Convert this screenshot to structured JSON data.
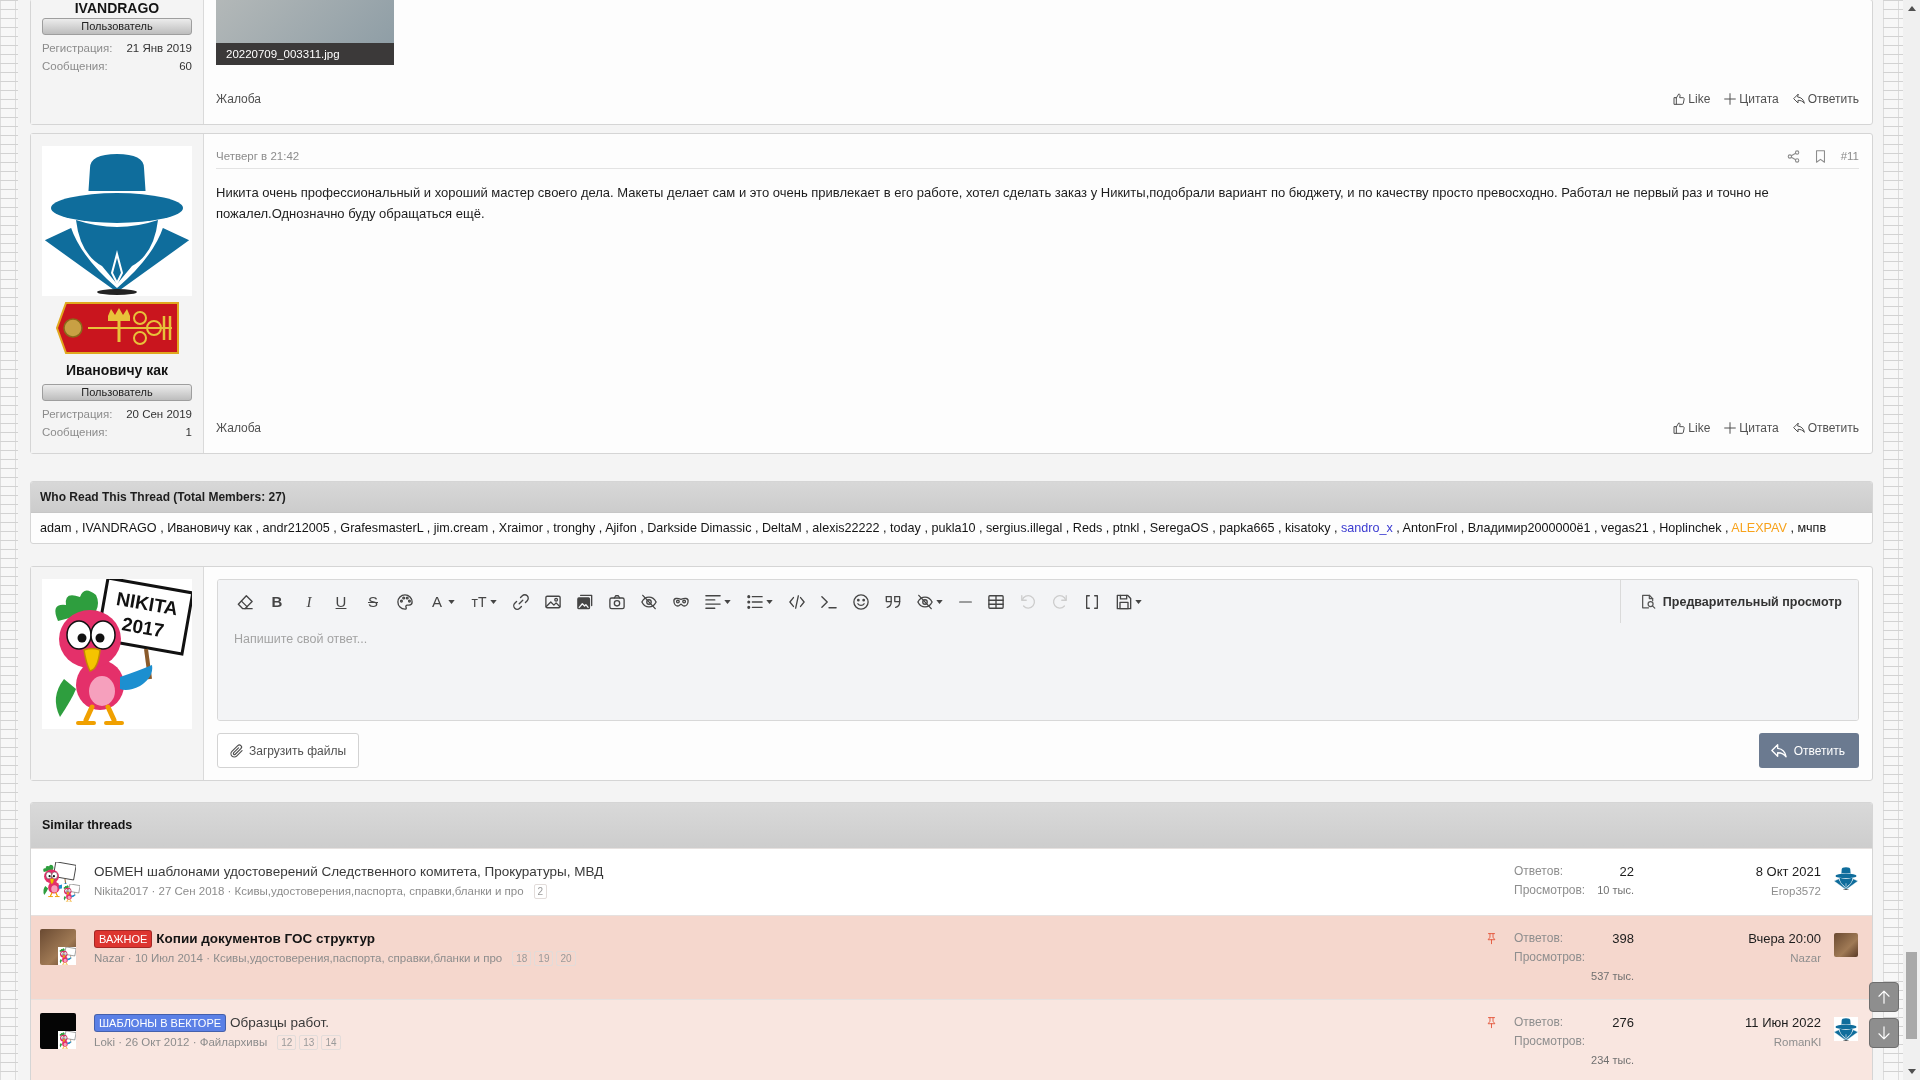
{
  "posts": [
    {
      "author": "IVANDRAGO",
      "role": "Пользователь",
      "stats": [
        {
          "label": "Регистрация:",
          "value": "21 Янв 2019"
        },
        {
          "label": "Сообщения:",
          "value": "60"
        }
      ],
      "attachments": [
        {
          "filename": "20220709_003311.jpg"
        }
      ],
      "report": "Жалоба",
      "actions": [
        {
          "kind": "like",
          "label": "Like"
        },
        {
          "kind": "quote",
          "label": "Цитата"
        },
        {
          "kind": "reply",
          "label": "Ответить"
        }
      ]
    },
    {
      "avatar": {
        "kind": "hat-figure"
      },
      "rank_insignia": true,
      "author": "Ивановичу как",
      "role": "Пользователь",
      "stats": [
        {
          "label": "Регистрация:",
          "value": "20 Сен 2019"
        },
        {
          "label": "Сообщения:",
          "value": "1"
        }
      ],
      "date": "Четверг в 21:42",
      "number": "#11",
      "text": "Никита очень профессиональный и хороший мастер своего дела. Макеты делает сам и это очень привлекает в его работе, хотел сделать заказ у Никиты,подобрали вариант по бюджету, и по качеству просто превосходно. Работал не первый раз и точно не пожалел.Однозначно буду обращаться ещё.",
      "report": "Жалоба",
      "actions": [
        {
          "kind": "like",
          "label": "Like"
        },
        {
          "kind": "quote",
          "label": "Цитата"
        },
        {
          "kind": "reply",
          "label": "Ответить"
        }
      ]
    }
  ],
  "who_read": {
    "title": "Who Read This Thread (Total Members: 27)",
    "separator": ",",
    "members": [
      {
        "name": "adam",
        "color": "#141414"
      },
      {
        "name": "IVANDRAGO",
        "color": "#141414"
      },
      {
        "name": "Ивановичу как",
        "color": "#141414"
      },
      {
        "name": "andr212005",
        "color": "#141414"
      },
      {
        "name": "GrafesmasterL",
        "color": "#141414"
      },
      {
        "name": "jim.cream",
        "color": "#141414"
      },
      {
        "name": "Xraimor",
        "color": "#141414"
      },
      {
        "name": "tronghy",
        "color": "#141414"
      },
      {
        "name": "Ajifon",
        "color": "#141414"
      },
      {
        "name": "Darkside Dimassic",
        "color": "#141414"
      },
      {
        "name": "DeltaM",
        "color": "#141414"
      },
      {
        "name": "alexis22222",
        "color": "#141414"
      },
      {
        "name": "today",
        "color": "#141414"
      },
      {
        "name": "pukla10",
        "color": "#141414"
      },
      {
        "name": "sergius.illegal",
        "color": "#141414"
      },
      {
        "name": "Reds",
        "color": "#141414"
      },
      {
        "name": "ptnkl",
        "color": "#141414"
      },
      {
        "name": "SeregaOS",
        "color": "#141414"
      },
      {
        "name": "papka665",
        "color": "#141414"
      },
      {
        "name": "kisatoky",
        "color": "#141414"
      },
      {
        "name": "sandro_x",
        "color": "#3a3ad0"
      },
      {
        "name": "AntonFrol",
        "color": "#141414"
      },
      {
        "name": "Владимир2000000ё1",
        "color": "#141414"
      },
      {
        "name": "vegas21",
        "color": "#141414"
      },
      {
        "name": "Hoplinchek",
        "color": "#141414"
      },
      {
        "name": "ALEXPAV",
        "color": "#f7a21b"
      },
      {
        "name": "мчпв",
        "color": "#141414"
      }
    ]
  },
  "reply": {
    "avatar": {
      "kind": "parrot",
      "sign": [
        "NIKITA",
        "2017"
      ]
    },
    "toolbar": [
      {
        "kind": "eraser",
        "dropdown": false,
        "disabled": false
      },
      {
        "kind": "bold",
        "label": "B",
        "dropdown": false,
        "disabled": false
      },
      {
        "kind": "italic",
        "label": "I",
        "dropdown": false,
        "disabled": false
      },
      {
        "kind": "underline",
        "label": "U",
        "dropdown": false,
        "disabled": false
      },
      {
        "kind": "strike",
        "label": "S",
        "dropdown": false,
        "disabled": false
      },
      {
        "kind": "palette",
        "dropdown": false,
        "disabled": false
      },
      {
        "kind": "font-color",
        "label": "A",
        "dropdown": true,
        "disabled": false
      },
      {
        "kind": "font-size",
        "label": "тT",
        "dropdown": true,
        "disabled": false
      },
      {
        "kind": "link",
        "dropdown": false,
        "disabled": false
      },
      {
        "kind": "image",
        "dropdown": false,
        "disabled": false
      },
      {
        "kind": "media",
        "dropdown": false,
        "disabled": false
      },
      {
        "kind": "camera",
        "dropdown": false,
        "disabled": false
      },
      {
        "kind": "hide",
        "dropdown": false,
        "disabled": false
      },
      {
        "kind": "spoiler",
        "dropdown": false,
        "disabled": false
      },
      {
        "kind": "align",
        "dropdown": true,
        "disabled": false
      },
      {
        "kind": "list",
        "dropdown": true,
        "disabled": false
      },
      {
        "kind": "code",
        "dropdown": false,
        "disabled": false
      },
      {
        "kind": "inline-code",
        "dropdown": false,
        "disabled": false
      },
      {
        "kind": "smilie",
        "dropdown": false,
        "disabled": false
      },
      {
        "kind": "quote",
        "dropdown": false,
        "disabled": false
      },
      {
        "kind": "hide-menu",
        "dropdown": true,
        "disabled": false
      },
      {
        "kind": "hr",
        "dropdown": false,
        "disabled": false
      },
      {
        "kind": "table",
        "dropdown": false,
        "disabled": false
      },
      {
        "kind": "undo",
        "dropdown": false,
        "disabled": true
      },
      {
        "kind": "redo",
        "dropdown": false,
        "disabled": true
      },
      {
        "kind": "bbcode",
        "dropdown": false,
        "disabled": false
      },
      {
        "kind": "drafts",
        "dropdown": true,
        "disabled": false
      }
    ],
    "preview": "Предварительный просмотр",
    "placeholder": "Напишите свой ответ...",
    "upload": "Загрузить файлы",
    "submit": "Ответить"
  },
  "similar_threads": {
    "title": "Similar threads",
    "threads": [
      {
        "avatar": {
          "kind": "parrot"
        },
        "overlay_avatar": {
          "kind": "parrot"
        },
        "sticky": false,
        "unread": false,
        "title": "ОБМЕН шаблонами удостоверений Следственного комитета, Прокуратуры, МВД",
        "meta": "Nikita2017 · 27 Сен 2018 · Ксивы,удостоверения,паспорта, справки,бланки и про",
        "pages": [
          "2"
        ],
        "replies_label": "Ответов:",
        "replies": "22",
        "views_label": "Просмотров:",
        "views": "10 тыс.",
        "last_date": "8 Окт 2021",
        "last_user": "Егор3572",
        "last_avatar": {
          "kind": "hat-figure"
        }
      },
      {
        "avatar": {
          "kind": "photo"
        },
        "overlay_avatar": {
          "kind": "parrot"
        },
        "sticky": true,
        "unread": true,
        "prefix": {
          "label": "ВАЖНОЕ",
          "color": "#dd3530"
        },
        "title": "Копии документов ГОС структур",
        "meta": "Nazar · 10 Июл 2014 · Ксивы,удостоверения,паспорта, справки,бланки и про",
        "pages": [
          "18",
          "19",
          "20"
        ],
        "replies_label": "Ответов:",
        "replies": "398",
        "views_label": "Просмотров:",
        "views": "537 тыс.",
        "last_date": "Вчера 20:00",
        "last_user": "Nazar",
        "last_avatar": {
          "kind": "photo"
        }
      },
      {
        "avatar": {
          "kind": "dark"
        },
        "overlay_avatar": {
          "kind": "parrot"
        },
        "sticky": true,
        "unread": false,
        "prefix": {
          "label": "ШАБЛОНЫ В ВЕКТОРЕ",
          "color": "#5b80e6"
        },
        "title": "Образцы работ.",
        "meta": "Loki · 26 Окт 2012 · Файлархивы",
        "pages": [
          "12",
          "13",
          "14"
        ],
        "replies_label": "Ответов:",
        "replies": "276",
        "views_label": "Просмотров:",
        "views": "234 тыс.",
        "last_date": "11 Июн 2022",
        "last_user": "RomanKl",
        "last_avatar": {
          "kind": "hat-figure"
        }
      }
    ]
  }
}
